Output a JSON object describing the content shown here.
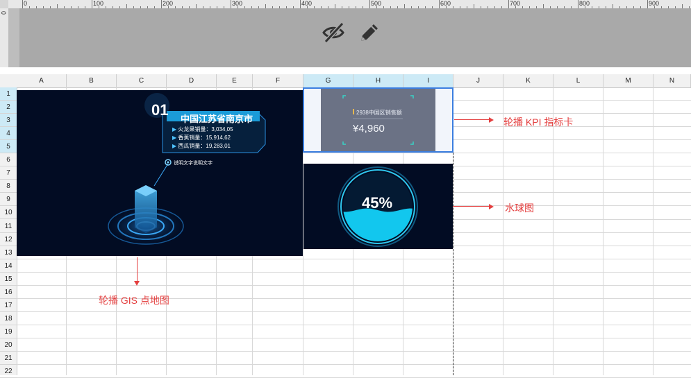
{
  "ruler": {
    "labels": [
      "0",
      "100",
      "200",
      "300",
      "400",
      "500",
      "600",
      "700",
      "800",
      "900"
    ],
    "vertical_label": "0"
  },
  "toolbar": {
    "icons": [
      "eye-off-icon",
      "pencil-icon"
    ]
  },
  "grid": {
    "columns": [
      "A",
      "B",
      "C",
      "D",
      "E",
      "F",
      "G",
      "H",
      "I",
      "J",
      "K",
      "L",
      "M",
      "N"
    ],
    "selected_columns": [
      "G",
      "H",
      "I"
    ],
    "rows": [
      "1",
      "2",
      "3",
      "4",
      "5",
      "6",
      "7",
      "8",
      "9",
      "10",
      "11",
      "12",
      "13",
      "14",
      "15",
      "16",
      "17",
      "18",
      "19",
      "20",
      "21",
      "22"
    ],
    "selected_rows": [
      "1",
      "2",
      "3",
      "4",
      "5"
    ]
  },
  "gis": {
    "index": "01",
    "location": "中国江苏省南京市",
    "stats": [
      {
        "label": "火龙果销量：",
        "value": "3,034,05"
      },
      {
        "label": "香蕉销量：",
        "value": "15,914,62"
      },
      {
        "label": "西瓜销量：",
        "value": "19,283,01"
      }
    ],
    "caption": "说明文字说明文字"
  },
  "kpi": {
    "title": "2938中国区销售额",
    "value": "¥4,960"
  },
  "water": {
    "percent_label": "45%",
    "level": 0.45
  },
  "annotations": {
    "kpi": "轮播 KPI 指标卡",
    "water": "水球图",
    "gis": "轮播 GIS 点地图"
  },
  "colors": {
    "accent": "#3b7ee0",
    "annotation": "#e43f3f",
    "widget_bg": "#020c23",
    "water": "#12c7ee"
  }
}
